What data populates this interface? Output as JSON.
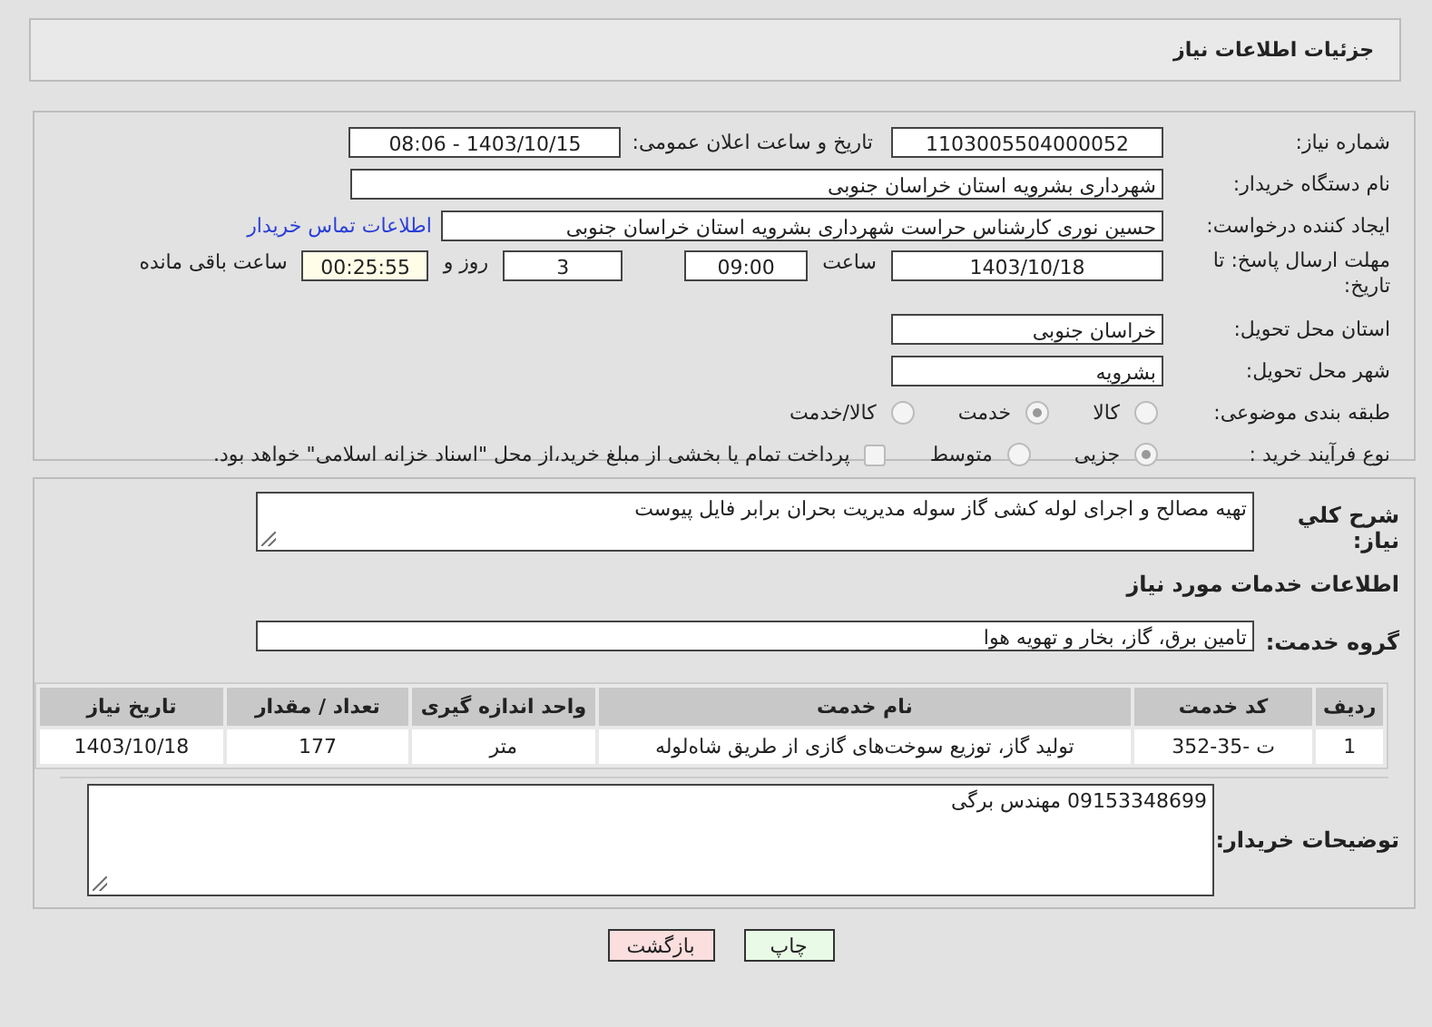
{
  "header": {
    "title": "جزئیات اطلاعات نیاز"
  },
  "details": {
    "need_number": {
      "label": "شماره نیاز:",
      "value": "1103005504000052"
    },
    "announce": {
      "label": "تاریخ و ساعت اعلان عمومی:",
      "value": "1403/10/15 - 08:06"
    },
    "buyer": {
      "label": "نام دستگاه خریدار:",
      "value": "شهرداری بشرویه استان خراسان جنوبی"
    },
    "creator": {
      "label": "ایجاد کننده درخواست:",
      "value": "حسین نوری کارشناس حراست شهرداری بشرویه استان خراسان جنوبی",
      "link": "اطلاعات تماس خریدار"
    },
    "deadline": {
      "label": "مهلت ارسال پاسخ: تا تاریخ:",
      "date": "1403/10/18",
      "time_label": "ساعت",
      "time": "09:00",
      "days": "3",
      "days_label": "روز و",
      "remaining": "00:25:55",
      "remaining_label": "ساعت باقی مانده"
    },
    "province": {
      "label": "استان محل تحویل:",
      "value": "خراسان جنوبی"
    },
    "city": {
      "label": "شهر محل تحویل:",
      "value": "بشرویه"
    },
    "category": {
      "label": "طبقه بندی موضوعی:",
      "options": [
        {
          "label": "کالا",
          "selected": false
        },
        {
          "label": "خدمت",
          "selected": true
        },
        {
          "label": "کالا/خدمت",
          "selected": false
        }
      ]
    },
    "process": {
      "label": "نوع فرآیند خرید :",
      "options": [
        {
          "label": "جزیی",
          "selected": true
        },
        {
          "label": "متوسط",
          "selected": false
        }
      ],
      "payment": {
        "label": "پرداخت تمام یا بخشی از مبلغ خرید،از محل \"اسناد خزانه اسلامی\" خواهد بود.",
        "checked": false
      }
    }
  },
  "services": {
    "summary": {
      "label": "شرح کلي نياز:",
      "value": "تهیه مصالح و اجرای لوله کشی گاز سوله مدیریت بحران  برابر فایل پیوست"
    },
    "heading": "اطلاعات خدمات مورد نیاز",
    "group": {
      "label": "گروه خدمت:",
      "value": "تامین برق، گاز، بخار و تهویه هوا"
    },
    "table": {
      "columns": [
        "ردیف",
        "کد خدمت",
        "نام خدمت",
        "واحد اندازه گیری",
        "تعداد / مقدار",
        "تاریخ نیاز"
      ],
      "rows": [
        [
          "1",
          "ت -35-352",
          "تولید گاز، توزیع سوخت‌های گازی از طریق شاه‌لوله",
          "متر",
          "177",
          "1403/10/18"
        ]
      ]
    },
    "notes": {
      "label": "توضیحات خریدار:",
      "value": "09153348699 مهندس برگی"
    }
  },
  "buttons": [
    {
      "label": "چاپ",
      "kind": "print"
    },
    {
      "label": "بازگشت",
      "kind": "back"
    }
  ]
}
